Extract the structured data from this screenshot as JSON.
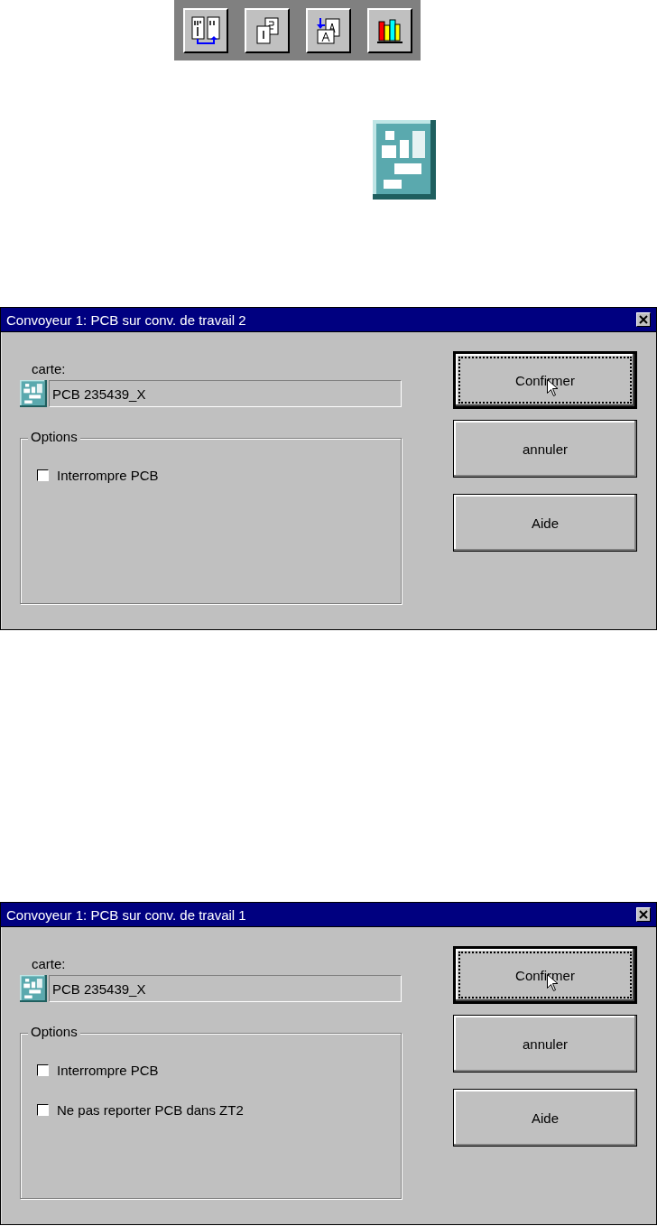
{
  "toolbar": {
    "buttons": [
      {
        "kind": "columns"
      },
      {
        "kind": "pages"
      },
      {
        "kind": "swap"
      },
      {
        "kind": "books"
      }
    ]
  },
  "dialogs": [
    {
      "title": "Convoyeur 1: PCB sur conv. de travail 2",
      "field_label": "carte:",
      "field_value": "PCB 235439_X",
      "group_title": "Options",
      "options": [
        {
          "label": "Interrompre PCB",
          "checked": false
        }
      ],
      "buttons": [
        {
          "label": "Confirmer",
          "focused": true
        },
        {
          "label": "annuler",
          "focused": false
        },
        {
          "label": "Aide",
          "focused": false
        }
      ]
    },
    {
      "title": "Convoyeur 1: PCB sur conv. de travail 1",
      "field_label": "carte:",
      "field_value": "PCB 235439_X",
      "group_title": "Options",
      "options": [
        {
          "label": "Interrompre PCB",
          "checked": false
        },
        {
          "label": "Ne pas reporter PCB dans ZT2",
          "checked": false
        }
      ],
      "buttons": [
        {
          "label": "Confirmer",
          "focused": true
        },
        {
          "label": "annuler",
          "focused": false
        },
        {
          "label": "Aide",
          "focused": false
        }
      ]
    }
  ]
}
